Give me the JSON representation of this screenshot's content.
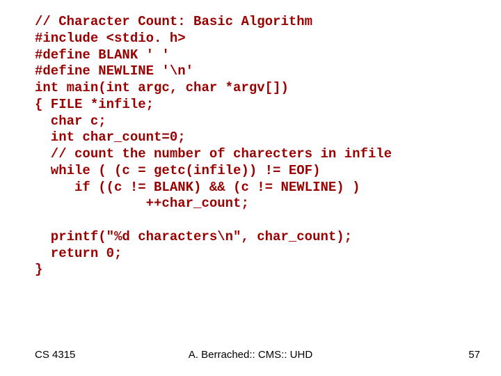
{
  "code": {
    "l0": "// Character Count: Basic Algorithm",
    "l1": "#include <stdio. h>",
    "l2": "#define BLANK ' '",
    "l3": "#define NEWLINE '\\n'",
    "l4": "int main(int argc, char *argv[])",
    "l5": "{ FILE *infile;",
    "l6": "  char c;",
    "l7": "  int char_count=0;",
    "l8": "  // count the number of charecters in infile",
    "l9": "  while ( (c = getc(infile)) != EOF)",
    "l10": "     if ((c != BLANK) && (c != NEWLINE) )",
    "l11": "              ++char_count;",
    "l12": "",
    "l13": "  printf(\"%d characters\\n\", char_count);",
    "l14": "  return 0;",
    "l15": "}"
  },
  "footer": {
    "left": "CS 4315",
    "center": "A. Berrached:: CMS:: UHD",
    "right": "57"
  }
}
